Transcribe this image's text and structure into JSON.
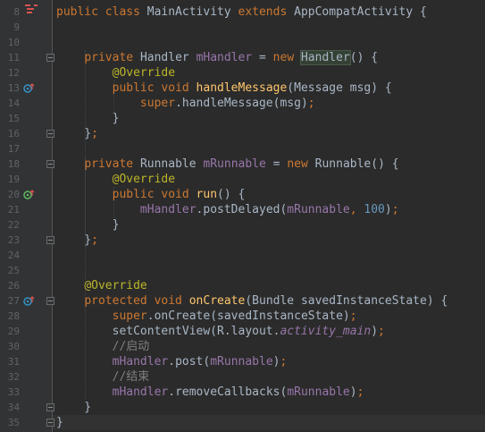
{
  "editor": {
    "gutter": {
      "line_numbers": [
        "8",
        "9",
        "10",
        "11",
        "12",
        "13",
        "14",
        "15",
        "16",
        "17",
        "18",
        "19",
        "20",
        "21",
        "22",
        "23",
        "24",
        "25",
        "26",
        "27",
        "28",
        "29",
        "30",
        "31",
        "32",
        "33",
        "34",
        "35"
      ]
    },
    "lines": [
      {
        "number": "8",
        "tokens": [
          [
            "kw",
            "public class "
          ],
          [
            "",
            "MainActivity "
          ],
          [
            "kw",
            "extends "
          ],
          [
            "",
            "AppCompatActivity {"
          ]
        ]
      },
      {
        "number": "9",
        "tokens": []
      },
      {
        "number": "10",
        "tokens": []
      },
      {
        "number": "11",
        "tokens": [
          [
            "",
            "    "
          ],
          [
            "kw",
            "private "
          ],
          [
            "",
            "Handler "
          ],
          [
            "fld",
            "mHandler"
          ],
          [
            "",
            " = "
          ],
          [
            "kw",
            "new "
          ],
          [
            "hl",
            "Handler"
          ],
          [
            "",
            "() {"
          ]
        ]
      },
      {
        "number": "12",
        "tokens": [
          [
            "",
            "        "
          ],
          [
            "ann",
            "@Override"
          ]
        ]
      },
      {
        "number": "13",
        "tokens": [
          [
            "",
            "        "
          ],
          [
            "kw",
            "public void "
          ],
          [
            "mth",
            "handleMessage"
          ],
          [
            "",
            "(Message msg) {"
          ]
        ]
      },
      {
        "number": "14",
        "tokens": [
          [
            "",
            "            "
          ],
          [
            "kw",
            "super"
          ],
          [
            "",
            ".handleMessage(msg)"
          ],
          [
            "kw",
            ";"
          ]
        ]
      },
      {
        "number": "15",
        "tokens": [
          [
            "",
            "        }"
          ]
        ]
      },
      {
        "number": "16",
        "tokens": [
          [
            "",
            "    }"
          ],
          [
            "kw",
            ";"
          ]
        ]
      },
      {
        "number": "17",
        "tokens": []
      },
      {
        "number": "18",
        "tokens": [
          [
            "",
            "    "
          ],
          [
            "kw",
            "private "
          ],
          [
            "",
            "Runnable "
          ],
          [
            "fld",
            "mRunnable"
          ],
          [
            "",
            " = "
          ],
          [
            "kw",
            "new "
          ],
          [
            "",
            "Runnable() {"
          ]
        ]
      },
      {
        "number": "19",
        "tokens": [
          [
            "",
            "        "
          ],
          [
            "ann",
            "@Override"
          ]
        ]
      },
      {
        "number": "20",
        "tokens": [
          [
            "",
            "        "
          ],
          [
            "kw",
            "public void "
          ],
          [
            "mth",
            "run"
          ],
          [
            "",
            "() {"
          ]
        ]
      },
      {
        "number": "21",
        "tokens": [
          [
            "",
            "            "
          ],
          [
            "fld",
            "mHandler"
          ],
          [
            "",
            ".postDelayed("
          ],
          [
            "fld",
            "mRunnable"
          ],
          [
            "kw",
            ", "
          ],
          [
            "num",
            "100"
          ],
          [
            "",
            ")"
          ],
          [
            "kw",
            ";"
          ]
        ]
      },
      {
        "number": "22",
        "tokens": [
          [
            "",
            "        }"
          ]
        ]
      },
      {
        "number": "23",
        "tokens": [
          [
            "",
            "    }"
          ],
          [
            "kw",
            ";"
          ]
        ]
      },
      {
        "number": "24",
        "tokens": []
      },
      {
        "number": "25",
        "tokens": []
      },
      {
        "number": "26",
        "tokens": [
          [
            "",
            "    "
          ],
          [
            "ann",
            "@Override"
          ]
        ]
      },
      {
        "number": "27",
        "tokens": [
          [
            "",
            "    "
          ],
          [
            "kw",
            "protected void "
          ],
          [
            "mth",
            "onCreate"
          ],
          [
            "",
            "(Bundle savedInstanceState) {"
          ]
        ]
      },
      {
        "number": "28",
        "tokens": [
          [
            "",
            "        "
          ],
          [
            "kw",
            "super"
          ],
          [
            "",
            ".onCreate(savedInstanceState)"
          ],
          [
            "kw",
            ";"
          ]
        ]
      },
      {
        "number": "29",
        "tokens": [
          [
            "",
            "        setContentView(R.layout."
          ],
          [
            "ital",
            "activity_main"
          ],
          [
            "",
            ")"
          ],
          [
            "kw",
            ";"
          ]
        ]
      },
      {
        "number": "30",
        "tokens": [
          [
            "",
            "        "
          ],
          [
            "cmt",
            "//启动"
          ]
        ]
      },
      {
        "number": "31",
        "tokens": [
          [
            "",
            "        "
          ],
          [
            "fld",
            "mHandler"
          ],
          [
            "",
            ".post("
          ],
          [
            "fld",
            "mRunnable"
          ],
          [
            "",
            ")"
          ],
          [
            "kw",
            ";"
          ]
        ]
      },
      {
        "number": "32",
        "tokens": [
          [
            "",
            "        "
          ],
          [
            "cmt",
            "//结束"
          ]
        ]
      },
      {
        "number": "33",
        "tokens": [
          [
            "",
            "        "
          ],
          [
            "fld",
            "mHandler"
          ],
          [
            "",
            ".removeCallbacks("
          ],
          [
            "fld",
            "mRunnable"
          ],
          [
            "",
            ")"
          ],
          [
            "kw",
            ";"
          ]
        ]
      },
      {
        "number": "34",
        "tokens": [
          [
            "",
            "    }"
          ]
        ]
      },
      {
        "number": "35",
        "tokens": [
          [
            "",
            "}"
          ]
        ]
      }
    ],
    "gutter_icons": [
      {
        "line": "13",
        "name": "override-method-icon"
      },
      {
        "line": "20",
        "name": "implement-method-icon"
      },
      {
        "line": "27",
        "name": "override-method-icon"
      }
    ],
    "fold_markers": [
      "11",
      "16",
      "18",
      "23",
      "27",
      "34",
      "35"
    ],
    "colors": {
      "background": "#2b2b2b",
      "gutter": "#313335",
      "keyword": "#cc7832",
      "annotation": "#bbb529",
      "field": "#9876aa",
      "method": "#ffc66d",
      "number": "#6897bb",
      "comment": "#808080",
      "text": "#a9b7c6"
    }
  }
}
